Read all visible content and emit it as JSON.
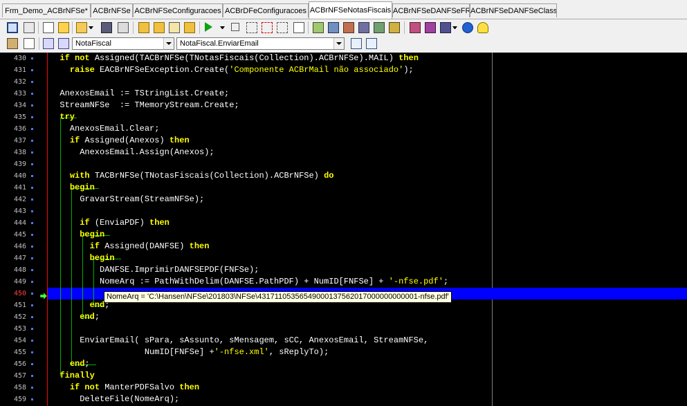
{
  "tabs": [
    {
      "label": "Frm_Demo_ACBrNFSe*",
      "active": false
    },
    {
      "label": "ACBrNFSe",
      "active": false
    },
    {
      "label": "ACBrNFSeConfiguracoes",
      "active": false
    },
    {
      "label": "ACBrDFeConfiguracoes",
      "active": false
    },
    {
      "label": "ACBrNFSeNotasFiscais",
      "active": true
    },
    {
      "label": "ACBrNFSeDANFSeFR",
      "active": false
    },
    {
      "label": "ACBrNFSeDANFSeClass",
      "active": false
    }
  ],
  "toolbar2": {
    "class_combo": "NotaFiscal",
    "method_combo": "NotaFiscal.EnviarEmail"
  },
  "editor": {
    "current_line": "450",
    "tooltip": "NomeArq = 'C:\\Hansen\\NFSe\\201803\\NFSe\\43171105356549000137562017000000000001-nfse.pdf'",
    "lines": [
      {
        "n": "430",
        "code": "  if not Assigned(TACBrNFSe(TNotasFiscais(Collection).ACBrNFSe).MAIL) then"
      },
      {
        "n": "431",
        "code": "    raise EACBrNFSeException.Create('Componente ACBrMail não associado');"
      },
      {
        "n": "432",
        "code": ""
      },
      {
        "n": "433",
        "code": "  AnexosEmail := TStringList.Create;"
      },
      {
        "n": "434",
        "code": "  StreamNFSe  := TMemoryStream.Create;"
      },
      {
        "n": "435",
        "code": "  try"
      },
      {
        "n": "436",
        "code": "    AnexosEmail.Clear;"
      },
      {
        "n": "437",
        "code": "    if Assigned(Anexos) then"
      },
      {
        "n": "438",
        "code": "      AnexosEmail.Assign(Anexos);"
      },
      {
        "n": "439",
        "code": ""
      },
      {
        "n": "440",
        "code": "    with TACBrNFSe(TNotasFiscais(Collection).ACBrNFSe) do"
      },
      {
        "n": "441",
        "code": "    begin"
      },
      {
        "n": "442",
        "code": "      GravarStream(StreamNFSe);"
      },
      {
        "n": "443",
        "code": ""
      },
      {
        "n": "444",
        "code": "      if (EnviaPDF) then"
      },
      {
        "n": "445",
        "code": "      begin"
      },
      {
        "n": "446",
        "code": "        if Assigned(DANFSE) then"
      },
      {
        "n": "447",
        "code": "        begin"
      },
      {
        "n": "448",
        "code": "          DANFSE.ImprimirDANFSEPDF(FNFSe);"
      },
      {
        "n": "449",
        "code": "          NomeArq := PathWithDelim(DANFSE.PathPDF) + NumID[FNFSe] + '-nfse.pdf';"
      },
      {
        "n": "450",
        "code": ""
      },
      {
        "n": "451",
        "code": "        end;"
      },
      {
        "n": "452",
        "code": "      end;"
      },
      {
        "n": "453",
        "code": ""
      },
      {
        "n": "454",
        "code": "      EnviarEmail( sPara, sAssunto, sMensagem, sCC, AnexosEmail, StreamNFSe,"
      },
      {
        "n": "455",
        "code": "                   NumID[FNFSe] +'-nfse.xml', sReplyTo);"
      },
      {
        "n": "456",
        "code": "    end;"
      },
      {
        "n": "457",
        "code": "  finally"
      },
      {
        "n": "458",
        "code": "    if not ManterPDFSalvo then"
      },
      {
        "n": "459",
        "code": "      DeleteFile(NomeArq);"
      }
    ]
  }
}
